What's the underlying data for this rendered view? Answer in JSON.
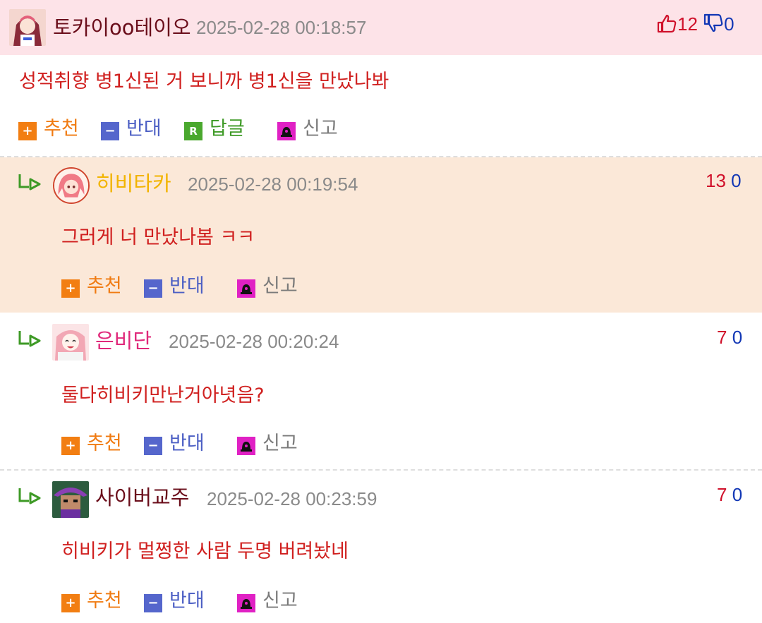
{
  "main_comment": {
    "nickname": "토카이oo테이오",
    "date": "2025-02-28 00:18:57",
    "up": "12",
    "down": "0",
    "text": "성적취향 병1신된 거 보니까 병1신을 만났나봐",
    "actions": {
      "recommend": "추천",
      "oppose": "반대",
      "reply": "답글",
      "report": "신고"
    },
    "nick_color": "#6a0d1a"
  },
  "replies": [
    {
      "nickname": "히비타카",
      "date": "2025-02-28 00:19:54",
      "up": "13",
      "down": "0",
      "text": "그러게 너 만났나봄 ㅋㅋ",
      "nick_color": "#f2b400",
      "highlight": true,
      "actions": {
        "recommend": "추천",
        "oppose": "반대",
        "report": "신고"
      }
    },
    {
      "nickname": "은비단",
      "date": "2025-02-28 00:20:24",
      "up": "7",
      "down": "0",
      "text": "둘다히비키만난거아녓음?",
      "nick_color": "#e0287a",
      "highlight": false,
      "actions": {
        "recommend": "추천",
        "oppose": "반대",
        "report": "신고"
      }
    },
    {
      "nickname": "사이버교주",
      "date": "2025-02-28 00:23:59",
      "up": "7",
      "down": "0",
      "text": "히비키가 멀쩡한 사람 두명 버려놨네",
      "nick_color": "#6a0d1a",
      "highlight": false,
      "actions": {
        "recommend": "추천",
        "oppose": "반대",
        "report": "신고"
      }
    }
  ],
  "colors": {
    "header_bg": "#fde3e8",
    "highlight_bg": "#fbe8d8",
    "text_red": "#d0201f",
    "up_red": "#d0112b",
    "down_blue": "#1237b5"
  },
  "icons": [
    "thumbs-up-icon",
    "thumbs-down-icon",
    "plus-icon",
    "minus-icon",
    "reply-icon",
    "report-icon",
    "reply-arrow-icon"
  ]
}
